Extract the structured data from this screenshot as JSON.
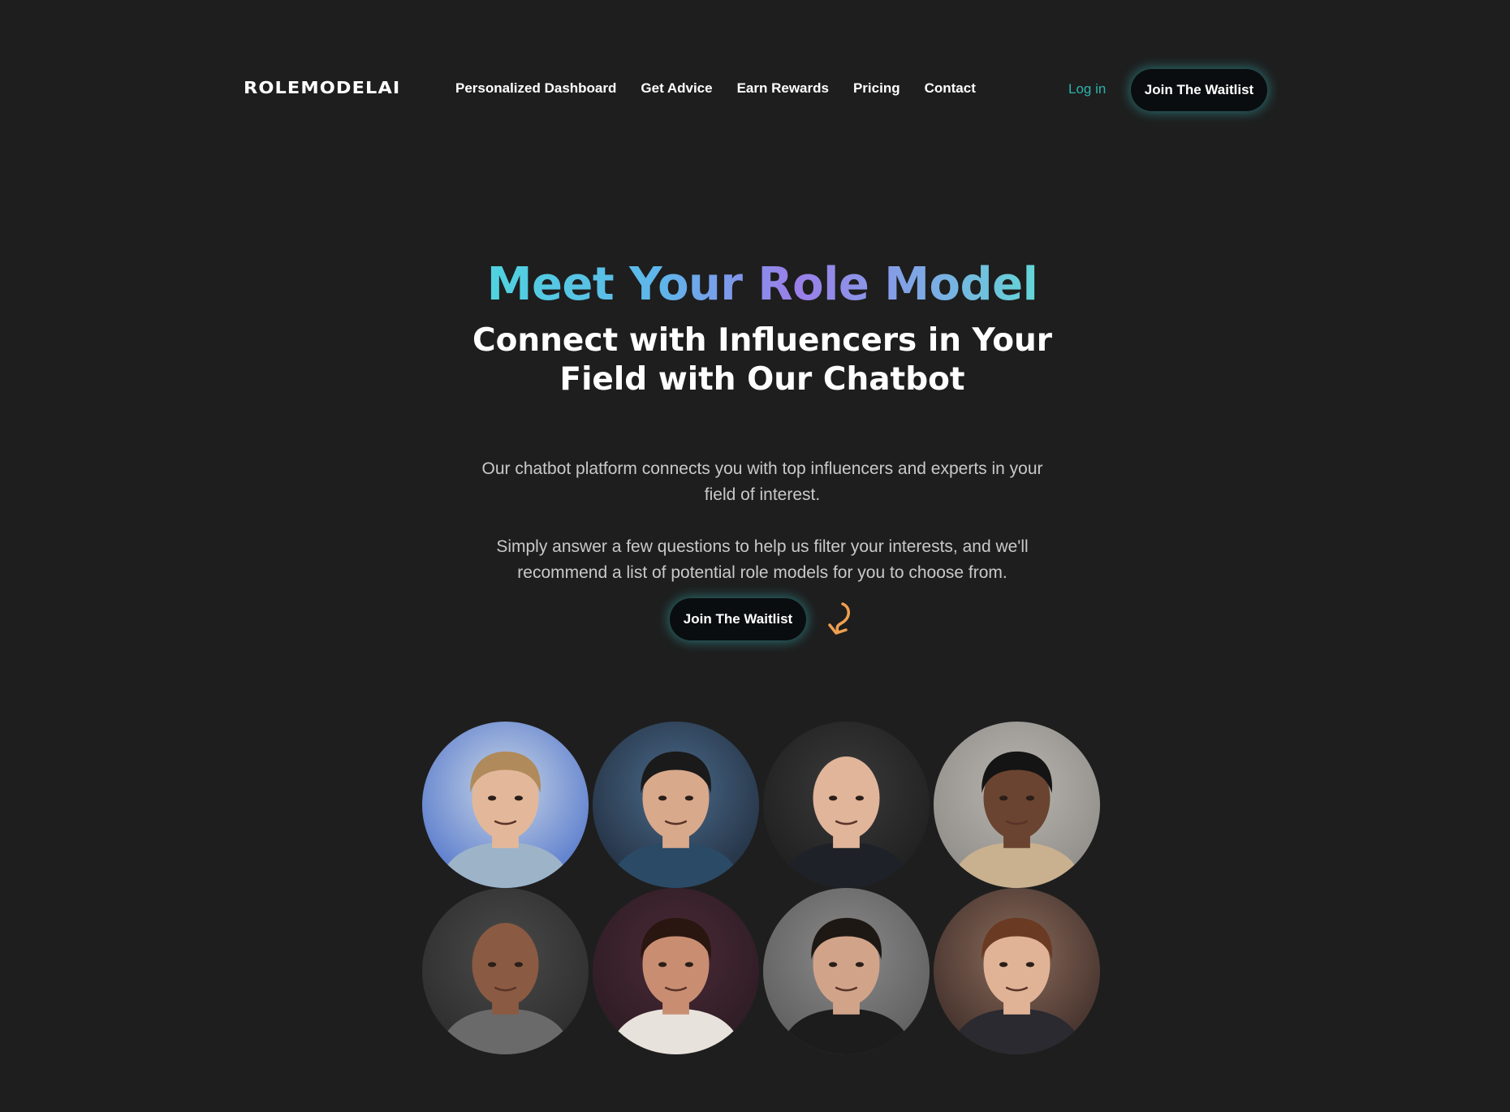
{
  "header": {
    "logo": "ROLEMODELAI",
    "nav": [
      {
        "label": "Personalized Dashboard"
      },
      {
        "label": "Get Advice"
      },
      {
        "label": "Earn Rewards"
      },
      {
        "label": "Pricing"
      },
      {
        "label": "Contact"
      }
    ],
    "login_label": "Log in",
    "cta_label": "Join The Waitlist"
  },
  "hero": {
    "title": "Meet Your Role Model",
    "subtitle_line1": "Connect with Influencers in Your",
    "subtitle_line2": "Field with Our Chatbot",
    "paragraph1": "Our chatbot platform connects you with top influencers and experts in your field of interest.",
    "paragraph2": "Simply answer a few questions to help us filter your interests, and we'll recommend a list of potential role models for you to choose from.",
    "cta_label": "Join The Waitlist",
    "cta_icon": "curved-arrow-icon"
  },
  "avatars": [
    {
      "bg": "#4a6fc9",
      "bg2": "#c9d6e6",
      "skin": "#e3b89a",
      "hair": "#b08a5a",
      "shirt": "#9db3c8",
      "bald": false
    },
    {
      "bg": "#1f2a3a",
      "bg2": "#4a6a8a",
      "skin": "#d9a98c",
      "hair": "#1a1a1a",
      "shirt": "#2b4a66",
      "bald": false
    },
    {
      "bg": "#1c1c1c",
      "bg2": "#3a3a3a",
      "skin": "#e1b59a",
      "hair": "#e1b59a",
      "shirt": "#1e2228",
      "bald": true
    },
    {
      "bg": "#8c8a86",
      "bg2": "#b8b4ae",
      "skin": "#6a4430",
      "hair": "#141414",
      "shirt": "#c9b08e",
      "bald": false
    },
    {
      "bg": "#2a2a2a",
      "bg2": "#4a4a4a",
      "skin": "#8a5a42",
      "hair": "#8a5a42",
      "shirt": "#6a6a6a",
      "bald": true
    },
    {
      "bg": "#2a1a22",
      "bg2": "#4a2a36",
      "skin": "#c98e72",
      "hair": "#2a1610",
      "shirt": "#e8e2dc",
      "bald": false
    },
    {
      "bg": "#5a5a5a",
      "bg2": "#8a8a8a",
      "skin": "#d1a48a",
      "hair": "#1e1814",
      "shirt": "#1c1c1c",
      "bald": false
    },
    {
      "bg": "#3a2a26",
      "bg2": "#8a6a5a",
      "skin": "#e0b397",
      "hair": "#6a3a22",
      "shirt": "#2a2a30",
      "bald": false
    }
  ],
  "colors": {
    "background": "#1e1e1e",
    "accent": "#2bb3ad",
    "arrow": "#f0a050"
  }
}
